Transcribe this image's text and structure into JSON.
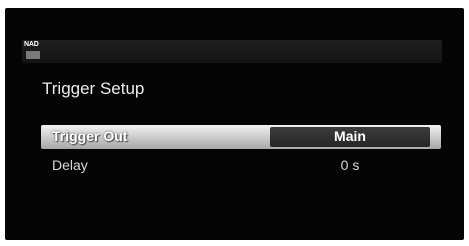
{
  "header": {
    "logo_text": "NAD"
  },
  "page": {
    "title": "Trigger Setup"
  },
  "settings": [
    {
      "label": "Trigger Out",
      "value": "Main",
      "selected": true
    },
    {
      "label": "Delay",
      "value": "0 s",
      "selected": false
    }
  ],
  "colors": {
    "background": "#050505",
    "highlight": "#c9c9c9",
    "value_box": "#2e2e2e",
    "text": "#ececec"
  }
}
